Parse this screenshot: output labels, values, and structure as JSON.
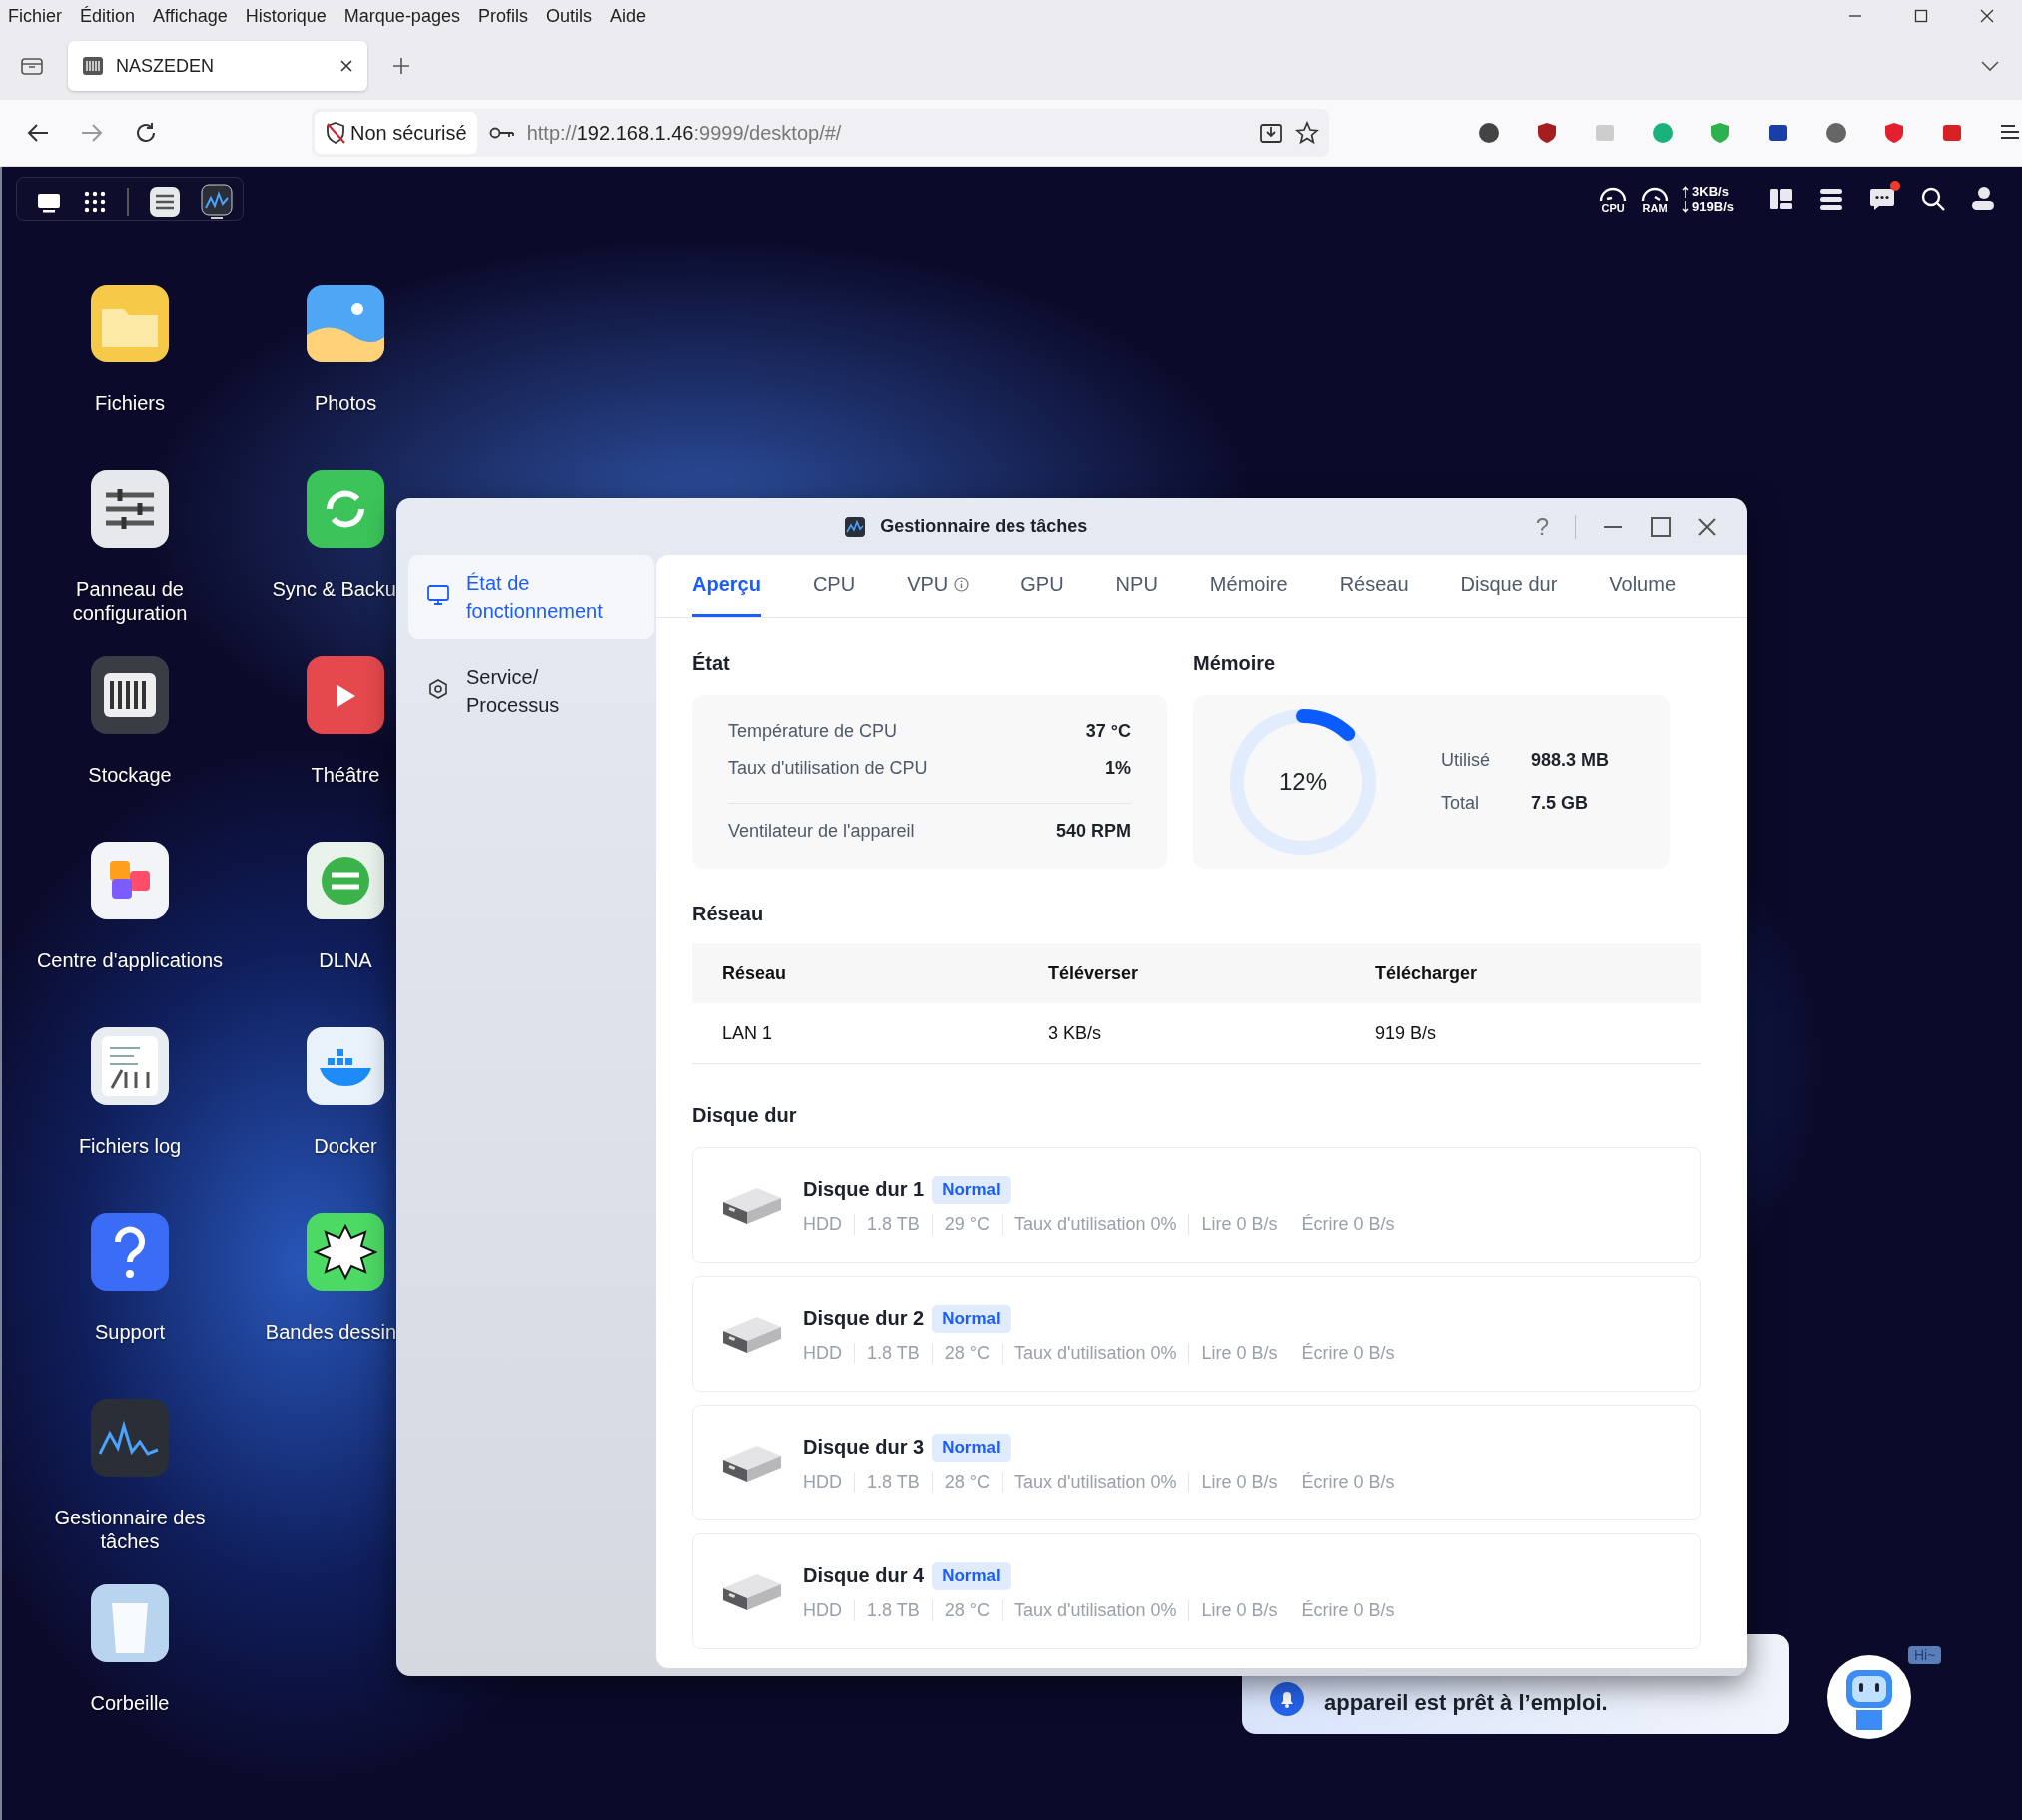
{
  "browser": {
    "menu": [
      "Fichier",
      "Édition",
      "Affichage",
      "Historique",
      "Marque-pages",
      "Profils",
      "Outils",
      "Aide"
    ],
    "tab": {
      "title": "NASZEDEN",
      "selected": true
    },
    "security": "Non sécurisé",
    "url": {
      "scheme": "http://",
      "host": "192.168.1.46",
      "rest": ":9999/desktop/#/"
    }
  },
  "desktop": {
    "status": {
      "cpu_label": "CPU",
      "ram_label": "RAM",
      "upload": "3KB/s",
      "download": "919B/s",
      "unread": true
    },
    "icon_columns": [
      [
        {
          "label": "Fichiers"
        },
        {
          "label": "Panneau de configuration"
        },
        {
          "label": "Stockage"
        },
        {
          "label": "Centre d'applications"
        },
        {
          "label": "Fichiers log"
        },
        {
          "label": "Support"
        },
        {
          "label": "Gestionnaire des tâches"
        },
        {
          "label": "Corbeille"
        }
      ],
      [
        {
          "label": "Photos"
        },
        {
          "label": "Sync & Backu"
        },
        {
          "label": "Théâtre"
        },
        {
          "label": "DLNA"
        },
        {
          "label": "Docker"
        },
        {
          "label": "Bandes dessin"
        }
      ]
    ]
  },
  "task_manager": {
    "title": "Gestionnaire des tâches",
    "help": "?",
    "sidebar": [
      {
        "label": "État de fonctionnement",
        "selected": true
      },
      {
        "label": "Service/ Processus",
        "selected": false
      }
    ],
    "tabs": [
      {
        "label": "Aperçu",
        "selected": true,
        "info": false
      },
      {
        "label": "CPU",
        "selected": false,
        "info": false
      },
      {
        "label": "VPU",
        "selected": false,
        "info": true
      },
      {
        "label": "GPU",
        "selected": false,
        "info": false
      },
      {
        "label": "NPU",
        "selected": false,
        "info": false
      },
      {
        "label": "Mémoire",
        "selected": false,
        "info": false
      },
      {
        "label": "Réseau",
        "selected": false,
        "info": false
      },
      {
        "label": "Disque dur",
        "selected": false,
        "info": false
      },
      {
        "label": "Volume",
        "selected": false,
        "info": false
      }
    ],
    "state": {
      "title": "État",
      "rows": [
        {
          "kind": "stat",
          "label": "Température de CPU",
          "value": "37 °C"
        },
        {
          "kind": "stat",
          "label": "Taux d'utilisation de CPU",
          "value": "1%"
        },
        {
          "kind": "divider"
        },
        {
          "kind": "stat",
          "label": "Ventilateur de l'appareil",
          "value": "540 RPM"
        }
      ]
    },
    "memory": {
      "title": "Mémoire",
      "level": 0.12,
      "percent": "12%",
      "rows": [
        {
          "label": "Utilisé",
          "value": "988.3 MB"
        },
        {
          "label": "Total",
          "value": "7.5 GB"
        }
      ]
    },
    "network": {
      "title": "Réseau",
      "columns": [
        "Réseau",
        "Téléverser",
        "Télécharger"
      ],
      "rows": [
        [
          "LAN 1",
          "3 KB/s",
          "919 B/s"
        ]
      ]
    },
    "disks": {
      "title": "Disque dur",
      "items": [
        {
          "name": "Disque dur 1",
          "status": "Normal",
          "details": [
            "HDD",
            "1.8 TB",
            "29 °C",
            "Taux d'utilisation 0%",
            "Lire 0 B/s",
            "Écrire 0 B/s"
          ]
        },
        {
          "name": "Disque dur 2",
          "status": "Normal",
          "details": [
            "HDD",
            "1.8 TB",
            "28 °C",
            "Taux d'utilisation 0%",
            "Lire 0 B/s",
            "Écrire 0 B/s"
          ]
        },
        {
          "name": "Disque dur 3",
          "status": "Normal",
          "details": [
            "HDD",
            "1.8 TB",
            "28 °C",
            "Taux d'utilisation 0%",
            "Lire 0 B/s",
            "Écrire 0 B/s"
          ]
        },
        {
          "name": "Disque dur 4",
          "status": "Normal",
          "details": [
            "HDD",
            "1.8 TB",
            "28 °C",
            "Taux d'utilisation 0%",
            "Lire 0 B/s",
            "Écrire 0 B/s"
          ]
        }
      ]
    }
  },
  "notification": {
    "text": "appareil est prêt à l’emploi."
  },
  "assistant": {
    "greeting": "Hi~"
  }
}
